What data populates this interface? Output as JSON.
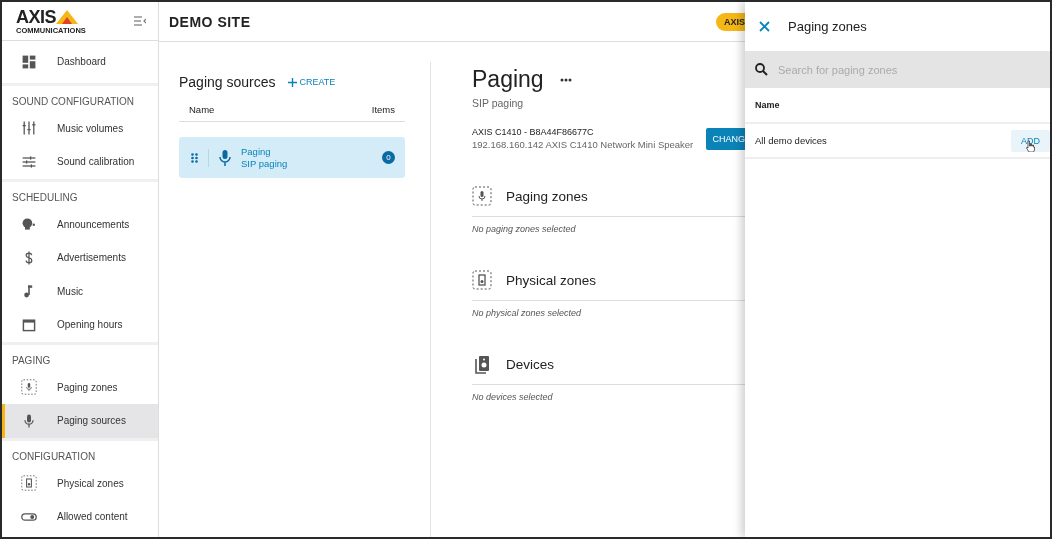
{
  "sidebar": {
    "logo": "AXIS",
    "logo_sub": "COMMUNICATIONS",
    "groups": [
      {
        "items": [
          {
            "kind": "dashboard",
            "label": "Dashboard",
            "selected": false
          }
        ]
      },
      {
        "title": "SOUND CONFIGURATION",
        "items": [
          {
            "kind": "sliders",
            "label": "Music volumes",
            "selected": false
          },
          {
            "kind": "tune",
            "label": "Sound calibration",
            "selected": false
          }
        ]
      },
      {
        "title": "SCHEDULING",
        "items": [
          {
            "kind": "speaker-person",
            "label": "Announcements",
            "selected": false
          },
          {
            "kind": "dollar",
            "label": "Advertisements",
            "selected": false
          },
          {
            "kind": "note",
            "label": "Music",
            "selected": false
          },
          {
            "kind": "calendar",
            "label": "Opening hours",
            "selected": false
          }
        ]
      },
      {
        "title": "PAGING",
        "items": [
          {
            "kind": "zone-mic",
            "label": "Paging zones",
            "selected": false
          },
          {
            "kind": "mic",
            "label": "Paging sources",
            "selected": true
          }
        ]
      },
      {
        "title": "CONFIGURATION",
        "items": [
          {
            "kind": "zone-speaker",
            "label": "Physical zones",
            "selected": false
          },
          {
            "kind": "toggle",
            "label": "Allowed content",
            "selected": false
          }
        ]
      }
    ]
  },
  "header": {
    "title": "DEMO SITE",
    "badge": "AXIS"
  },
  "sources": {
    "title": "Paging sources",
    "create": "CREATE",
    "columns": [
      "Name",
      "Items"
    ],
    "rows": [
      {
        "name": "Paging",
        "subtitle": "SIP paging",
        "count": "0",
        "selected": true
      }
    ]
  },
  "detail": {
    "title": "Paging",
    "subtitle": "SIP paging",
    "device_name": "AXIS C1410 - B8A44F86677C",
    "device_info": "192.168.160.142 AXIS C1410 Network Mini Speaker",
    "button": "CHANG",
    "sections": [
      {
        "kind": "zone-mic",
        "title": "Paging zones",
        "empty": "No paging zones selected"
      },
      {
        "kind": "zone-speaker",
        "title": "Physical zones",
        "empty": "No physical zones selected"
      },
      {
        "kind": "devices",
        "title": "Devices",
        "empty": "No devices selected"
      }
    ]
  },
  "drawer": {
    "title": "Paging zones",
    "search": {
      "placeholder": "Search for paging zones"
    },
    "column": "Name",
    "rows": [
      {
        "name": "All demo devices",
        "action": "ADD",
        "hovered": true
      }
    ]
  }
}
